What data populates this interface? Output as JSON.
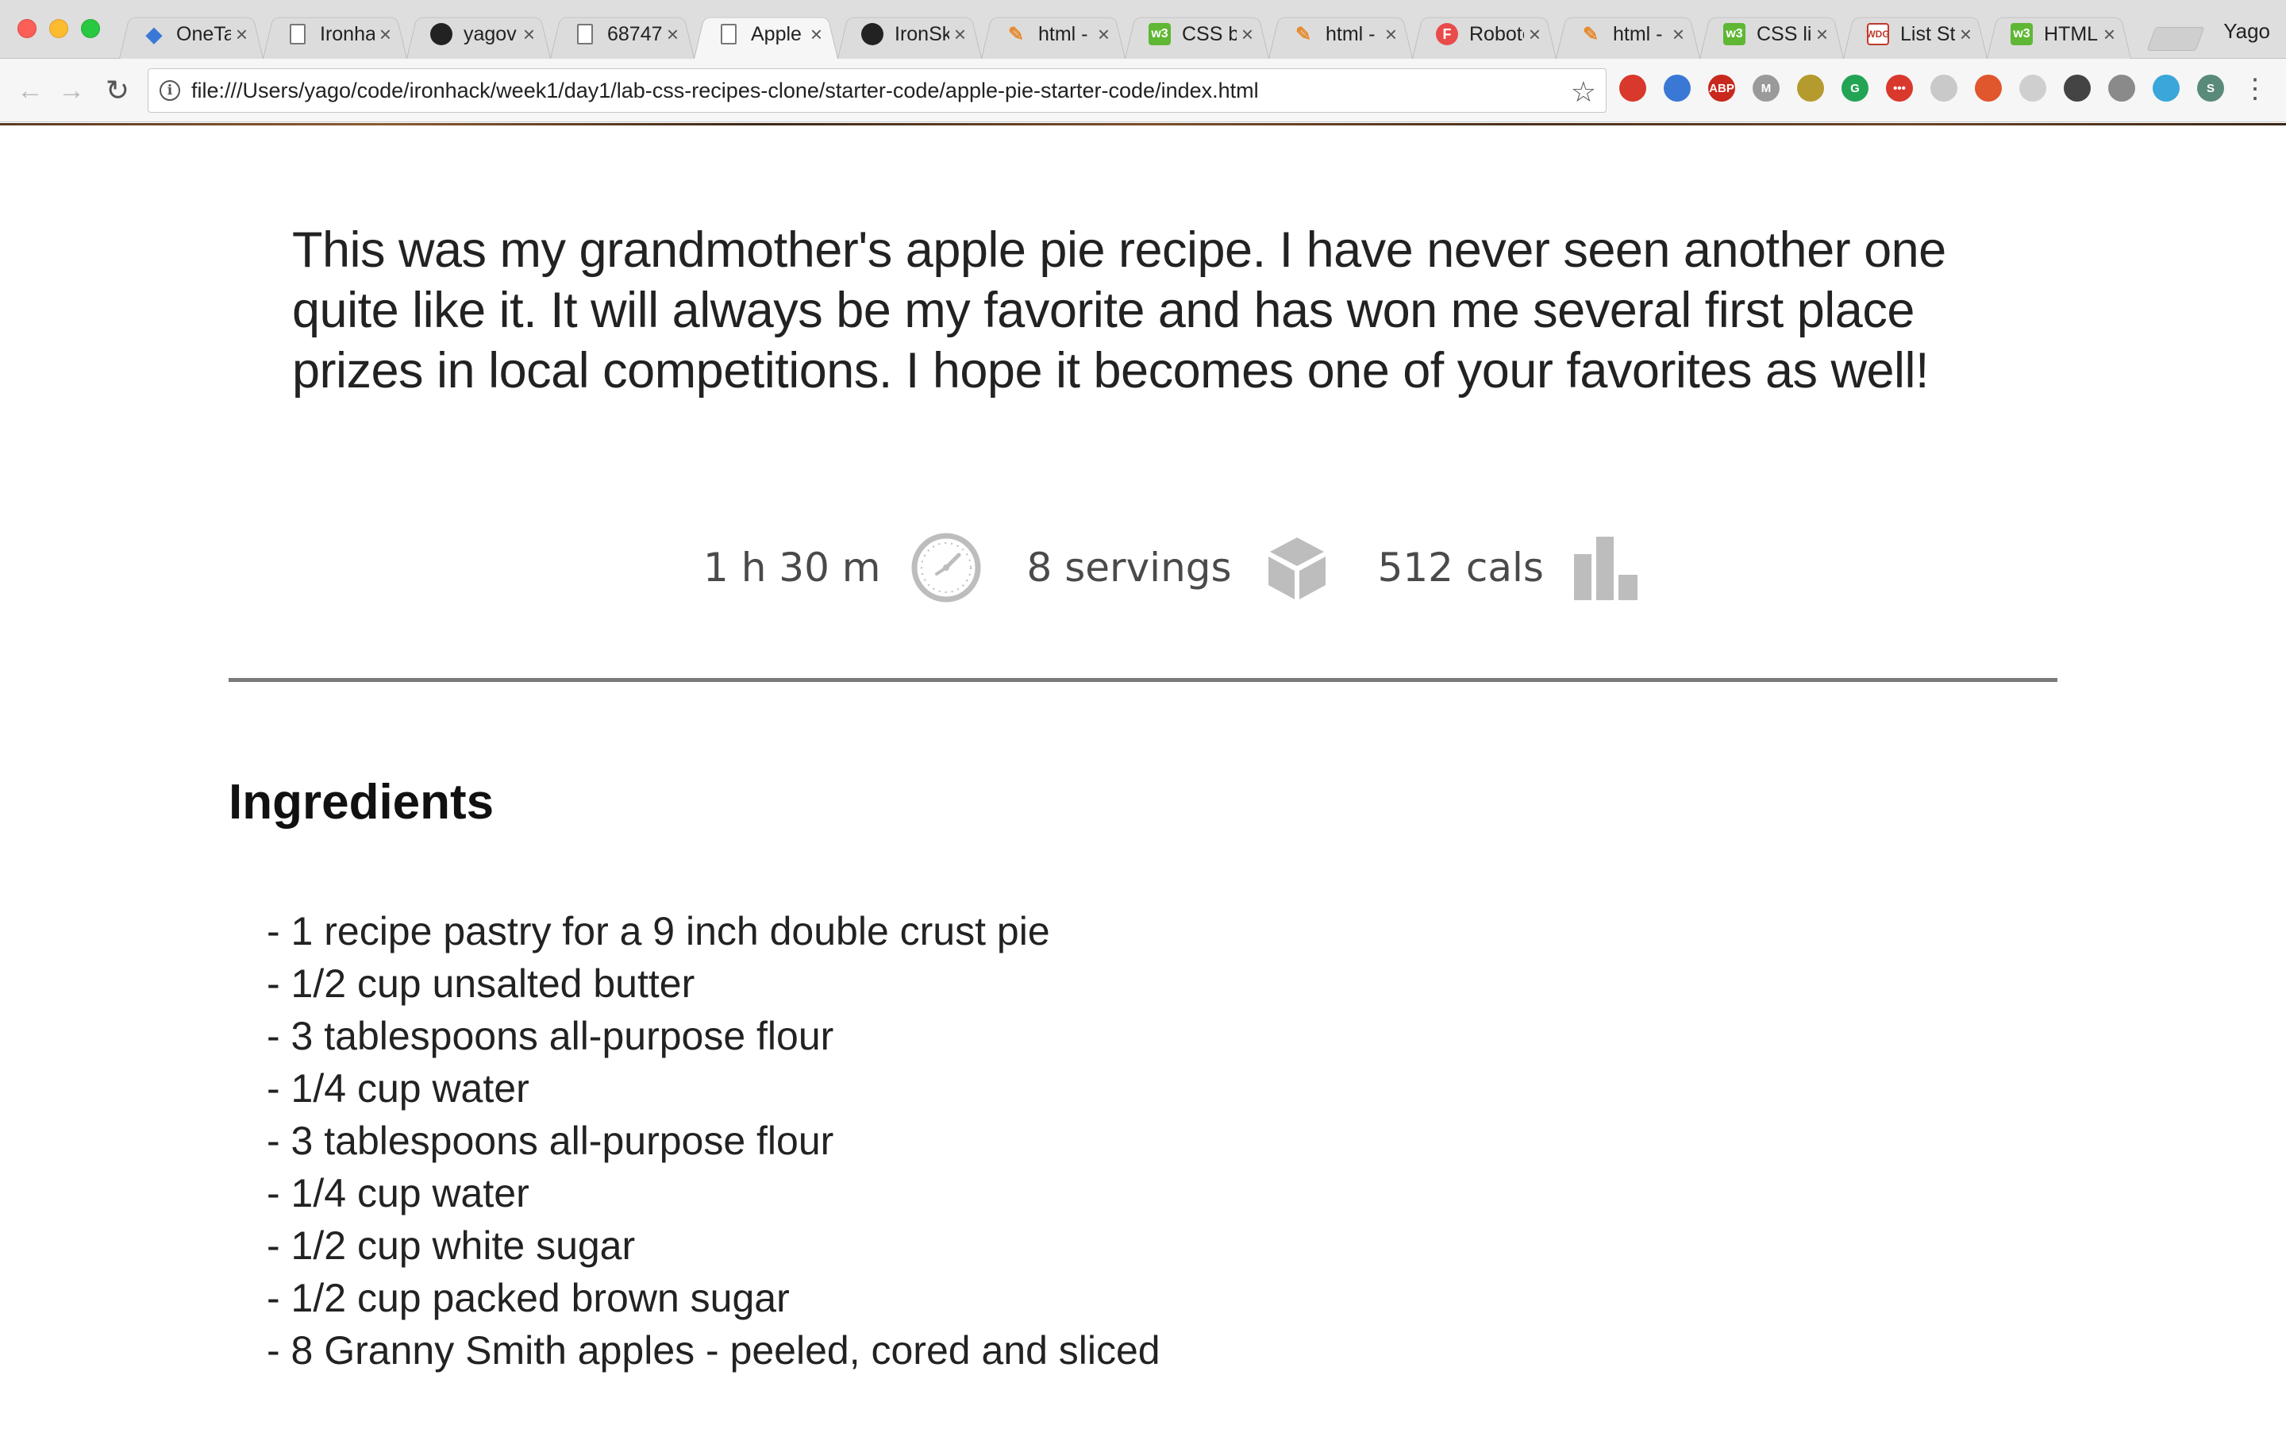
{
  "browser": {
    "tabs": [
      {
        "title": "OneTab",
        "icon": "diamond"
      },
      {
        "title": "Ironhack",
        "icon": "doc"
      },
      {
        "title": "yagov",
        "icon": "github"
      },
      {
        "title": "68747",
        "icon": "doc"
      },
      {
        "title": "Apple",
        "icon": "doc",
        "active": true
      },
      {
        "title": "IronSk",
        "icon": "github"
      },
      {
        "title": "html -",
        "icon": "pen"
      },
      {
        "title": "CSS b",
        "icon": "w3"
      },
      {
        "title": "html -",
        "icon": "pen"
      },
      {
        "title": "Roboto",
        "icon": "f"
      },
      {
        "title": "html -",
        "icon": "pen"
      },
      {
        "title": "CSS lis",
        "icon": "w3"
      },
      {
        "title": "List St",
        "icon": "wdg"
      },
      {
        "title": "HTML",
        "icon": "w3"
      }
    ],
    "tab_icon_glyphs": {
      "f": "F",
      "wdg": "WDG",
      "w3": "w3",
      "pen": "✎",
      "diamond": "◆"
    },
    "profile": "Yago",
    "url": "file:///Users/yago/code/ironhack/week1/day1/lab-css-recipes-clone/starter-code/apple-pie-starter-code/index.html",
    "close_glyph": "×",
    "extensions": [
      {
        "label": "",
        "color": "#d9382c"
      },
      {
        "label": "",
        "color": "#3a78d6"
      },
      {
        "label": "ABP",
        "color": "#c8281e"
      },
      {
        "label": "M",
        "color": "#9a9a9a"
      },
      {
        "label": "",
        "color": "#b59a2e"
      },
      {
        "label": "G",
        "color": "#23a455"
      },
      {
        "label": "•••",
        "color": "#d9382c"
      },
      {
        "label": "",
        "color": "#c9c9c9"
      },
      {
        "label": "",
        "color": "#e0562d"
      },
      {
        "label": "",
        "color": "#cfcfcf"
      },
      {
        "label": "",
        "color": "#444444"
      },
      {
        "label": "",
        "color": "#8a8a8a"
      },
      {
        "label": "",
        "color": "#3aa6d9"
      },
      {
        "label": "S",
        "color": "#5a8a7a"
      }
    ]
  },
  "recipe": {
    "intro": "This was my grandmother's apple pie recipe. I have never seen another one quite like it. It will always be my favorite and has won me several first place prizes in local competitions. I hope it becomes one of your favorites as well!",
    "stats": {
      "time": "1 h 30 m",
      "servings": "8 servings",
      "calories": "512 cals"
    },
    "ingredients_heading": "Ingredients",
    "ingredients": [
      "- 1 recipe pastry for a 9 inch double crust pie",
      "- 1/2 cup unsalted butter",
      "- 3 tablespoons all-purpose flour",
      "- 1/4 cup water",
      "- 3 tablespoons all-purpose flour",
      "- 1/4 cup water",
      "- 1/2 cup white sugar",
      "- 1/2 cup packed brown sugar",
      "- 8 Granny Smith apples - peeled, cored and sliced"
    ],
    "icon_color": "#bdbdbd"
  }
}
